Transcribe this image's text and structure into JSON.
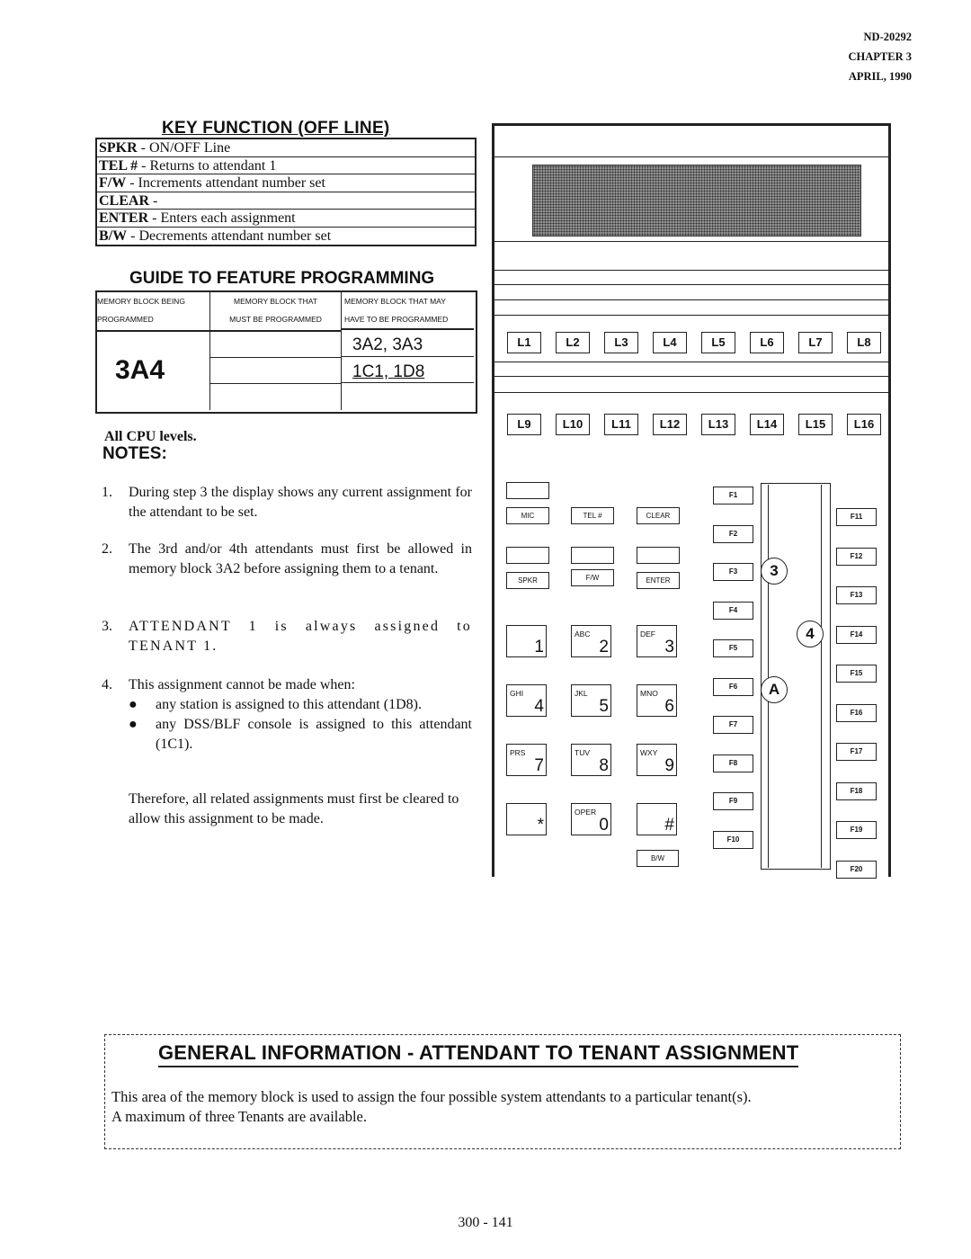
{
  "header": {
    "doc_number": "ND-20292",
    "chapter": "CHAPTER 3",
    "date": "APRIL, 1990"
  },
  "key_function": {
    "title": "KEY FUNCTION (OFF LINE)",
    "rows": [
      {
        "key": "SPKR",
        "desc": " - ON/OFF Line"
      },
      {
        "key": "TEL #",
        "desc": " - Returns to attendant 1"
      },
      {
        "key": "F/W",
        "desc": " - Increments attendant number set"
      },
      {
        "key": "CLEAR",
        "desc": " -"
      },
      {
        "key": "ENTER",
        "desc": " - Enters each assignment"
      },
      {
        "key": "B/W",
        "desc": " - Decrements attendant number set"
      }
    ]
  },
  "guide": {
    "title": "GUIDE TO FEATURE PROGRAMMING",
    "headers": [
      [
        "MEMORY BLOCK BEING",
        "PROGRAMMED"
      ],
      [
        "MEMORY BLOCK THAT",
        "MUST BE PROGRAMMED"
      ],
      [
        "MEMORY BLOCK THAT MAY",
        "HAVE TO BE PROGRAMMED"
      ]
    ],
    "block_being_programmed": "3A4",
    "must_be_programmed": [
      "",
      "",
      ""
    ],
    "may_have_to_be_programmed": [
      "3A2, 3A3",
      "1C1, 1D8",
      ""
    ]
  },
  "cpu_levels": "All CPU levels.",
  "notes": {
    "title": "NOTES:",
    "items": [
      {
        "num": "1.",
        "text": "During step 3 the display shows any current assignment for the attendant to be set."
      },
      {
        "num": "2.",
        "text": "The 3rd and/or 4th attendants must first be allowed in memory block 3A2  before assigning them to a tenant."
      },
      {
        "num": "3.",
        "text": "ATTENDANT 1 is always assigned to TENANT 1."
      },
      {
        "num": "4.",
        "text": "This assignment cannot be made when:"
      }
    ],
    "bullets": [
      "any station is assigned to this  attendant (1D8).",
      "any DSS/BLF console is assigned to this attendant (1C1)."
    ],
    "bullet_glyph": "●",
    "footer": "Therefore, all related assignments must first be cleared to allow this assignment to be made."
  },
  "phone": {
    "line_keys_row1": [
      "L1",
      "L2",
      "L3",
      "L4",
      "L5",
      "L6",
      "L7",
      "L8"
    ],
    "line_keys_row2": [
      "L9",
      "L10",
      "L11",
      "L12",
      "L13",
      "L14",
      "L15",
      "L16"
    ],
    "func_row1": [
      "MIC",
      "TEL #",
      "CLEAR"
    ],
    "func_row2": [
      "SPKR",
      "F/W",
      "ENTER"
    ],
    "dial_keys": [
      {
        "letters": "",
        "digit": "1"
      },
      {
        "letters": "ABC",
        "digit": "2"
      },
      {
        "letters": "DEF",
        "digit": "3"
      },
      {
        "letters": "GHI",
        "digit": "4"
      },
      {
        "letters": "JKL",
        "digit": "5"
      },
      {
        "letters": "MNO",
        "digit": "6"
      },
      {
        "letters": "PRS",
        "digit": "7"
      },
      {
        "letters": "TUV",
        "digit": "8"
      },
      {
        "letters": "WXY",
        "digit": "9"
      },
      {
        "letters": "",
        "digit": "*"
      },
      {
        "letters": "OPER",
        "digit": "0"
      },
      {
        "letters": "",
        "digit": "#"
      }
    ],
    "bw_key": "B/W",
    "f_keys_left": [
      "F1",
      "F2",
      "F3",
      "F4",
      "F5",
      "F6",
      "F7",
      "F8",
      "F9",
      "F10"
    ],
    "f_keys_right": [
      "F11",
      "F12",
      "F13",
      "F14",
      "F15",
      "F16",
      "F17",
      "F18",
      "F19",
      "F20"
    ],
    "step_markers": [
      "3",
      "4",
      "A"
    ]
  },
  "general_info": {
    "title": "GENERAL INFORMATION  -  ATTENDANT TO TENANT ASSIGNMENT",
    "line1": "This area of the memory block is used to assign the four possible system attendants to a particular tenant(s).",
    "line2": "A maximum of three Tenants are available."
  },
  "page_number": "300 - 141"
}
